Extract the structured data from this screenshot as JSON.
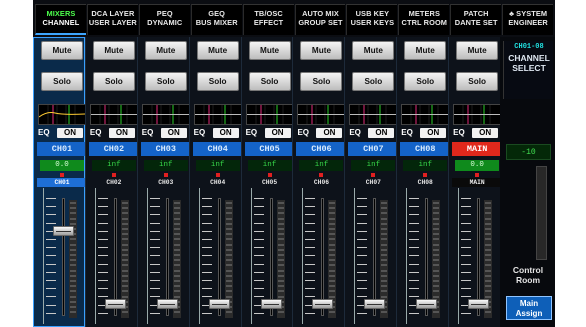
{
  "top_tabs": [
    {
      "l1": "MIXERS",
      "l2": "CHANNEL",
      "active": true
    },
    {
      "l1": "DCA LAYER",
      "l2": "USER LAYER",
      "active": false
    },
    {
      "l1": "PEQ",
      "l2": "DYNAMIC",
      "active": false
    },
    {
      "l1": "GEQ",
      "l2": "BUS MIXER",
      "active": false
    },
    {
      "l1": "TB/OSC",
      "l2": "EFFECT",
      "active": false
    },
    {
      "l1": "AUTO MIX",
      "l2": "GROUP SET",
      "active": false
    },
    {
      "l1": "USB KEY",
      "l2": "USER KEYS",
      "active": false
    },
    {
      "l1": "METERS",
      "l2": "CTRL ROOM",
      "active": false
    },
    {
      "l1": "PATCH",
      "l2": "DANTE SET",
      "active": false
    },
    {
      "l1": "♣ SYSTEM",
      "l2": "ENGINEER",
      "active": false
    }
  ],
  "buttons": {
    "mute": "Mute",
    "solo": "Solo",
    "eq": "EQ",
    "on": "ON"
  },
  "channels": [
    {
      "name": "CH01",
      "level": "0.0",
      "label": "CH01",
      "selected": true,
      "main": false,
      "fader": 0.7
    },
    {
      "name": "CH02",
      "level": "inf",
      "label": "CH02",
      "selected": false,
      "main": false,
      "fader": 0.04
    },
    {
      "name": "CH03",
      "level": "inf",
      "label": "CH03",
      "selected": false,
      "main": false,
      "fader": 0.04
    },
    {
      "name": "CH04",
      "level": "inf",
      "label": "CH04",
      "selected": false,
      "main": false,
      "fader": 0.04
    },
    {
      "name": "CH05",
      "level": "inf",
      "label": "CH05",
      "selected": false,
      "main": false,
      "fader": 0.04
    },
    {
      "name": "CH06",
      "level": "inf",
      "label": "CH06",
      "selected": false,
      "main": false,
      "fader": 0.04
    },
    {
      "name": "CH07",
      "level": "inf",
      "label": "CH07",
      "selected": false,
      "main": false,
      "fader": 0.04
    },
    {
      "name": "CH08",
      "level": "inf",
      "label": "CH08",
      "selected": false,
      "main": false,
      "fader": 0.04
    },
    {
      "name": "MAIN",
      "level": "0.0",
      "label": "MAIN",
      "selected": false,
      "main": true,
      "fader": 0.04
    }
  ],
  "right_panel": {
    "selected_num": "CH01-08",
    "select_l1": "CHANNEL",
    "select_l2": "SELECT",
    "level": "-10",
    "control_l1": "Control",
    "control_l2": "Room",
    "assign_l1": "Main",
    "assign_l2": "Assign"
  },
  "colors": {
    "accent": "#1463c8",
    "main": "#e0281c",
    "green": "#4cff4c"
  }
}
